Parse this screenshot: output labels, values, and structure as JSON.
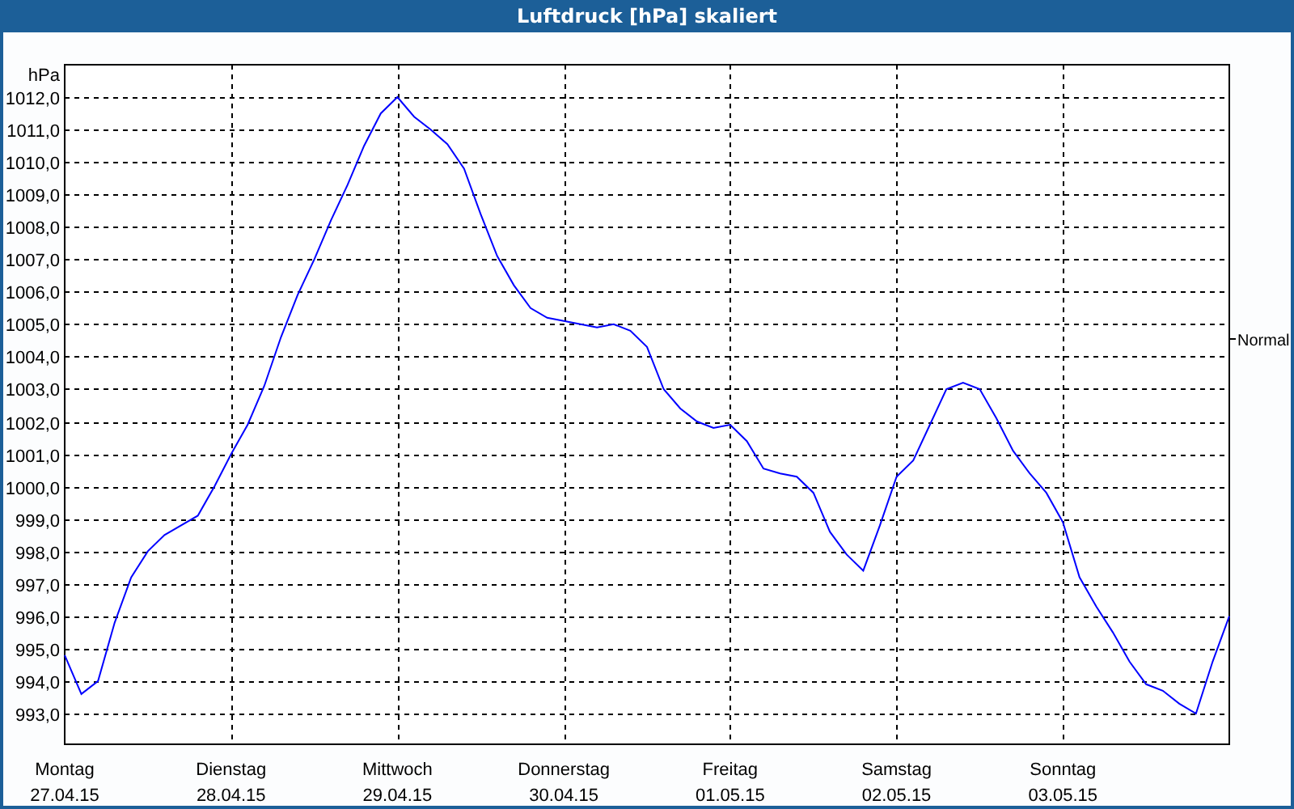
{
  "window": {
    "title": "Luftdruck [hPa] skaliert"
  },
  "chart": {
    "dates": [
      "27.04.15",
      "28.04.15",
      "29.04.15",
      "30.04.15",
      "01.05.15",
      "02.05.15",
      "03.05.15"
    ],
    "chart_data": {
      "type": "line",
      "grid": true,
      "ylabel": "hPa",
      "ylim": [
        992.05,
        1013
      ],
      "yticks": [
        {
          "value": 1012,
          "label": "1012,0"
        },
        {
          "value": 1011,
          "label": "1011,0"
        },
        {
          "value": 1010,
          "label": "1010,0"
        },
        {
          "value": 1009,
          "label": "1009,0"
        },
        {
          "value": 1008,
          "label": "1008,0"
        },
        {
          "value": 1007,
          "label": "1007,0"
        },
        {
          "value": 1006,
          "label": "1006,0"
        },
        {
          "value": 1005,
          "label": "1005,0"
        },
        {
          "value": 1004,
          "label": "1004,0"
        },
        {
          "value": 1003,
          "label": "1003,0"
        },
        {
          "value": 1002,
          "label": "1002,0"
        },
        {
          "value": 1001,
          "label": "1001,0"
        },
        {
          "value": 1000,
          "label": "1000,0"
        },
        {
          "value": 999,
          "label": "999,0"
        },
        {
          "value": 998,
          "label": "998,0"
        },
        {
          "value": 997,
          "label": "997,0"
        },
        {
          "value": 996,
          "label": "996,0"
        },
        {
          "value": 995,
          "label": "995,0"
        },
        {
          "value": 994,
          "label": "994,0"
        },
        {
          "value": 993,
          "label": "993,0"
        }
      ],
      "categories": [
        "Montag",
        null,
        null,
        null,
        null,
        null,
        null,
        null,
        null,
        null,
        "Dienstag",
        null,
        null,
        null,
        null,
        null,
        null,
        null,
        null,
        null,
        "Mittwoch",
        null,
        null,
        null,
        null,
        null,
        null,
        null,
        null,
        null,
        "Donnerstag",
        null,
        null,
        null,
        null,
        null,
        null,
        null,
        null,
        null,
        "Freitag",
        null,
        null,
        null,
        null,
        null,
        null,
        null,
        null,
        null,
        "Samstag",
        null,
        null,
        null,
        null,
        null,
        null,
        null,
        null,
        null,
        "Sonntag",
        null,
        null,
        null,
        null,
        null,
        null,
        null,
        null,
        null,
        null
      ],
      "series": [
        {
          "color": "#0000ff",
          "values": [
            994.8,
            993.6,
            994.0,
            995.8,
            997.2,
            998.0,
            998.5,
            998.8,
            999.1,
            1000.0,
            1001.0,
            1001.9,
            1003.1,
            1004.6,
            1005.9,
            1007.0,
            1008.2,
            1009.3,
            1010.5,
            1011.5,
            1012.0,
            1011.4,
            1011.0,
            1010.55,
            1009.8,
            1008.4,
            1007.1,
            1006.2,
            1005.5,
            1005.2,
            1005.1,
            1005.0,
            1004.9,
            1005.0,
            1004.8,
            1004.3,
            1003.0,
            1002.4,
            1002.0,
            1001.8,
            1001.9,
            1001.4,
            1000.55,
            1000.4,
            1000.3,
            999.8,
            998.6,
            997.9,
            997.4,
            998.8,
            1000.3,
            1000.8,
            1001.9,
            1003.0,
            1003.2,
            1003.0,
            1002.1,
            1001.1,
            1000.4,
            999.8,
            998.9,
            997.2,
            996.3,
            995.5,
            994.6,
            993.9,
            993.7,
            993.3,
            993.0,
            994.6,
            996.0
          ]
        }
      ],
      "annotations": [
        "Normal"
      ]
    }
  }
}
